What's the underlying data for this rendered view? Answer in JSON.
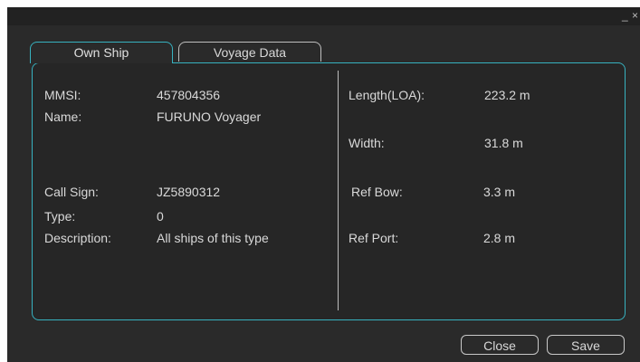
{
  "window": {
    "minimize_glyph": "_",
    "close_glyph": "×"
  },
  "tabs": [
    {
      "label": "Own Ship",
      "active": true
    },
    {
      "label": "Voyage Data",
      "active": false
    }
  ],
  "left_fields": [
    {
      "label": "MMSI:",
      "value": "457804356"
    },
    {
      "label": "Name:",
      "value": "FURUNO Voyager"
    },
    {
      "label": "Call Sign:",
      "value": "JZ5890312"
    },
    {
      "label": "Type:",
      "value": "0"
    },
    {
      "label": "Description:",
      "value": "All ships of this type"
    }
  ],
  "right_fields": [
    {
      "label": "Length(LOA):",
      "value": "223.2 m"
    },
    {
      "label": "Width:",
      "value": "31.8 m"
    },
    {
      "label": "Ref Bow:",
      "value": "3.3 m"
    },
    {
      "label": "Ref Port:",
      "value": "2.8 m"
    }
  ],
  "buttons": {
    "close": "Close",
    "save": "Save"
  },
  "colors": {
    "accent": "#37b2c0",
    "background": "#2a2a2a",
    "text": "#d9d9d9"
  }
}
